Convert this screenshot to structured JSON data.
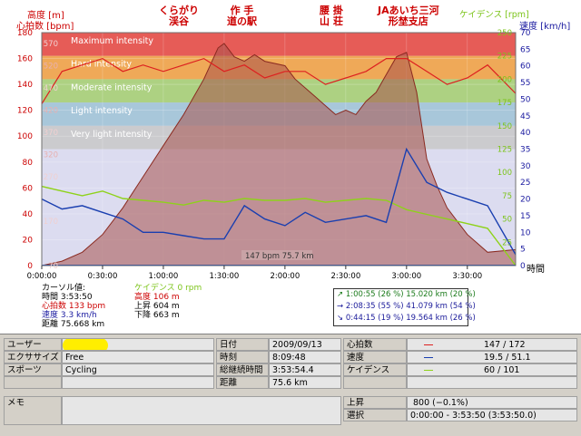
{
  "axes": {
    "left_title_top": "高度 [m]",
    "left_title_bottom": "心拍数 [bpm]",
    "right_title_inner": "ケイデンス [rpm]",
    "right_title_outer": "速度 [km/h]",
    "x_unit": "時間",
    "hr_ticks": [
      "0",
      "20",
      "40",
      "60",
      "80",
      "100",
      "120",
      "140",
      "160",
      "180"
    ],
    "alt_ticks": [
      "70",
      "170",
      "270",
      "370",
      "470",
      "570"
    ],
    "alt_ticks_mid": [
      "320",
      "420",
      "520"
    ],
    "speed_ticks": [
      "0",
      "5",
      "10",
      "15",
      "20",
      "25",
      "30",
      "35",
      "40",
      "45",
      "50",
      "55",
      "60",
      "65",
      "70"
    ],
    "cad_ticks": [
      "25",
      "50",
      "75",
      "100",
      "125",
      "150",
      "175",
      "200",
      "225",
      "250"
    ],
    "time_ticks": [
      "0:00:00",
      "0:30:00",
      "1:00:00",
      "1:30:00",
      "2:00:00",
      "2:30:00",
      "3:00:00",
      "3:30:00"
    ]
  },
  "zones": [
    {
      "label": "Maximum intensity",
      "color": "#e8453c"
    },
    {
      "label": "Hard intensity",
      "color": "#f2a03d"
    },
    {
      "label": "Moderate intensity",
      "color": "#a4cf6e"
    },
    {
      "label": "Light intensity",
      "color": "#9fc3d6"
    },
    {
      "label": "Very light intensity",
      "color": "#c8c8c8"
    }
  ],
  "landmarks": [
    {
      "text": "くらがり\n渓谷"
    },
    {
      "text": "作 手\n道の駅"
    },
    {
      "text": "腰 掛\n山 荘"
    },
    {
      "text": "JAあいち三河\n形埜支店"
    }
  ],
  "cursor_label": "147 bpm 75.7 km",
  "cursor": {
    "header": "カーソル値:",
    "time": "時間 3:53:50",
    "hr": "心拍数 133 bpm",
    "speed": "速度 3.3 km/h",
    "distance": "距離 75.668 km",
    "cadence": "ケイデンス 0 rpm",
    "altitude": "高度 106 m",
    "ascent": "上昇 604 m",
    "descent": "下降 663 m"
  },
  "segments": [
    {
      "text": "↗ 1:00:55  (26 %) 15.020 km  (20 %)",
      "color": "#1a7a1a"
    },
    {
      "text": "→ 2:08:35  (55 %) 41.079 km  (54 %)",
      "color": "#1a1a9a"
    },
    {
      "text": "↘ 0:44:15  (19 %) 19.564 km  (26 %)",
      "color": "#1a1a9a"
    }
  ],
  "summary": {
    "user_label": "ユーザー",
    "user_value": "",
    "exercise_label": "エクササイズ",
    "exercise_value": "Free",
    "sport_label": "スポーツ",
    "sport_value": "Cycling",
    "memo_label": "メモ",
    "memo_value": "",
    "date_label": "日付",
    "date_value": "2009/09/13",
    "time_label": "時刻",
    "time_value": "8:09:48",
    "duration_label": "総継続時間",
    "duration_value": "3:53:54.4",
    "distance_label": "距離",
    "distance_value": "75.6 km",
    "hr_label": "心拍数",
    "hr_value": "147 / 172",
    "speed_label": "速度",
    "speed_value": "19.5 / 51.1",
    "cadence_label": "ケイデンス",
    "cadence_value": "60 / 101",
    "ascent_label": "上昇",
    "ascent_value": "800 (−0.1%)",
    "select_label": "選択",
    "select_value": "0:00:00 - 3:53:50 (3:53:50.0)"
  },
  "colors": {
    "hr": "#dd2020",
    "speed": "#1a3fb0",
    "cadence": "#8ed21a",
    "altitude_fill": "#a8524c",
    "hr_tick": "#cc0000",
    "speed_tick": "#1a1aa0",
    "cad_tick": "#7cc41a"
  },
  "chart_data": {
    "type": "line",
    "x_label": "時間",
    "x_range": [
      "0:00:00",
      "3:53:50"
    ],
    "series": [
      {
        "name": "高度 [m]",
        "unit": "m",
        "x": [
          "0:00:00",
          "0:10:00",
          "0:20:00",
          "0:30:00",
          "0:40:00",
          "0:50:00",
          "1:00:00",
          "1:10:00",
          "1:20:00",
          "1:27:00",
          "1:30:00",
          "1:35:00",
          "1:40:00",
          "1:45:00",
          "1:50:00",
          "2:00:00",
          "2:05:00",
          "2:10:00",
          "2:15:00",
          "2:20:00",
          "2:25:00",
          "2:30:00",
          "2:35:00",
          "2:40:00",
          "2:45:00",
          "2:50:00",
          "2:55:00",
          "3:00:00",
          "3:05:00",
          "3:10:00",
          "3:15:00",
          "3:20:00",
          "3:30:00",
          "3:40:00",
          "3:53:50"
        ],
        "y": [
          70,
          80,
          100,
          140,
          200,
          270,
          340,
          410,
          490,
          560,
          570,
          540,
          530,
          545,
          530,
          520,
          490,
          470,
          450,
          430,
          410,
          420,
          410,
          440,
          460,
          500,
          540,
          550,
          460,
          310,
          250,
          200,
          140,
          100,
          106
        ]
      },
      {
        "name": "心拍数 [bpm]",
        "unit": "bpm",
        "x": [
          "0:00:00",
          "0:10:00",
          "0:20:00",
          "0:30:00",
          "0:40:00",
          "0:50:00",
          "1:00:00",
          "1:10:00",
          "1:20:00",
          "1:30:00",
          "1:40:00",
          "1:50:00",
          "2:00:00",
          "2:10:00",
          "2:20:00",
          "2:30:00",
          "2:40:00",
          "2:50:00",
          "3:00:00",
          "3:10:00",
          "3:20:00",
          "3:30:00",
          "3:40:00",
          "3:53:50"
        ],
        "y": [
          125,
          150,
          155,
          160,
          150,
          155,
          150,
          155,
          160,
          150,
          155,
          145,
          150,
          150,
          140,
          145,
          150,
          160,
          160,
          150,
          140,
          145,
          155,
          133
        ]
      },
      {
        "name": "速度 [km/h]",
        "unit": "km/h",
        "x": [
          "0:00:00",
          "0:10:00",
          "0:20:00",
          "0:30:00",
          "0:40:00",
          "0:50:00",
          "1:00:00",
          "1:10:00",
          "1:20:00",
          "1:30:00",
          "1:40:00",
          "1:50:00",
          "2:00:00",
          "2:10:00",
          "2:20:00",
          "2:30:00",
          "2:40:00",
          "2:50:00",
          "3:00:00",
          "3:10:00",
          "3:20:00",
          "3:30:00",
          "3:40:00",
          "3:53:50"
        ],
        "y": [
          20,
          17,
          18,
          16,
          14,
          10,
          10,
          9,
          8,
          8,
          18,
          14,
          12,
          16,
          13,
          14,
          15,
          13,
          35,
          25,
          22,
          20,
          18,
          3.3
        ]
      },
      {
        "name": "ケイデンス [rpm]",
        "unit": "rpm",
        "x": [
          "0:00:00",
          "0:10:00",
          "0:20:00",
          "0:30:00",
          "0:40:00",
          "0:50:00",
          "1:00:00",
          "1:10:00",
          "1:20:00",
          "1:30:00",
          "1:40:00",
          "1:50:00",
          "2:00:00",
          "2:10:00",
          "2:20:00",
          "2:30:00",
          "2:40:00",
          "2:50:00",
          "3:00:00",
          "3:10:00",
          "3:20:00",
          "3:30:00",
          "3:40:00",
          "3:53:50"
        ],
        "y": [
          85,
          80,
          75,
          80,
          72,
          70,
          68,
          65,
          70,
          68,
          72,
          70,
          70,
          72,
          68,
          70,
          72,
          70,
          60,
          55,
          50,
          45,
          40,
          0
        ]
      }
    ],
    "zones_hr": [
      {
        "name": "Maximum intensity",
        "from": 162,
        "to": 180
      },
      {
        "name": "Hard intensity",
        "from": 144,
        "to": 162
      },
      {
        "name": "Moderate intensity",
        "from": 126,
        "to": 144
      },
      {
        "name": "Light intensity",
        "from": 108,
        "to": 126
      },
      {
        "name": "Very light intensity",
        "from": 90,
        "to": 108
      }
    ]
  }
}
